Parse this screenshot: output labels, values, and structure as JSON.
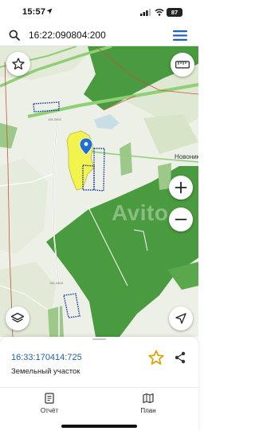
{
  "status_bar": {
    "time": "15:57",
    "battery": "87"
  },
  "search": {
    "query": "16:22:090804:200"
  },
  "map": {
    "place_label": "Новонико",
    "watermark": "Avito",
    "road_labels": [
      "16К-0800",
      "16К-0800"
    ],
    "icons": [
      "star-icon",
      "ruler-icon",
      "plus-icon",
      "minus-icon",
      "layers-icon",
      "location-arrow-icon",
      "map-pin-icon"
    ],
    "colors": {
      "forest": "#4a9a3f",
      "selected_parcel": "#f3f34d",
      "parcel_border": "#1a3aa5",
      "pin": "#1f6fd1",
      "highway": "#8fcf76",
      "district_border": "#c4553a"
    }
  },
  "sheet": {
    "cadastral_number": "16:33:170414:725",
    "parcel_type": "Земельный участок",
    "tabs": [
      {
        "label": "Отчёт",
        "icon": "report-icon"
      },
      {
        "label": "План",
        "icon": "map-plan-icon"
      }
    ],
    "colors": {
      "link": "#1e5fa8",
      "star": "#d9a400"
    }
  }
}
